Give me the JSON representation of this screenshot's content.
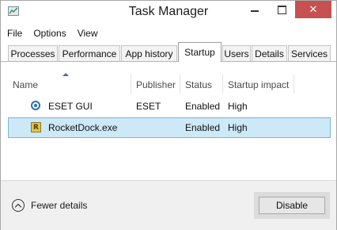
{
  "window": {
    "title": "Task Manager"
  },
  "menu": {
    "items": [
      "File",
      "Options",
      "View"
    ]
  },
  "tabs": [
    "Processes",
    "Performance",
    "App history",
    "Startup",
    "Users",
    "Details",
    "Services"
  ],
  "active_tab": "Startup",
  "columns": {
    "name": "Name",
    "publisher": "Publisher",
    "status": "Status",
    "impact": "Startup impact"
  },
  "rows": [
    {
      "name": "ESET GUI",
      "publisher": "ESET",
      "status": "Enabled",
      "impact": "High",
      "icon": "eset-icon"
    },
    {
      "name": "RocketDock.exe",
      "publisher": "",
      "status": "Enabled",
      "impact": "High",
      "icon": "rocketdock-icon",
      "icon_letter": "R"
    }
  ],
  "footer": {
    "fewer_details": "Fewer details",
    "disable": "Disable"
  },
  "colors": {
    "close_button": "#c75050",
    "selection": "#cde8f7",
    "selection_border": "#7ab4d8"
  }
}
